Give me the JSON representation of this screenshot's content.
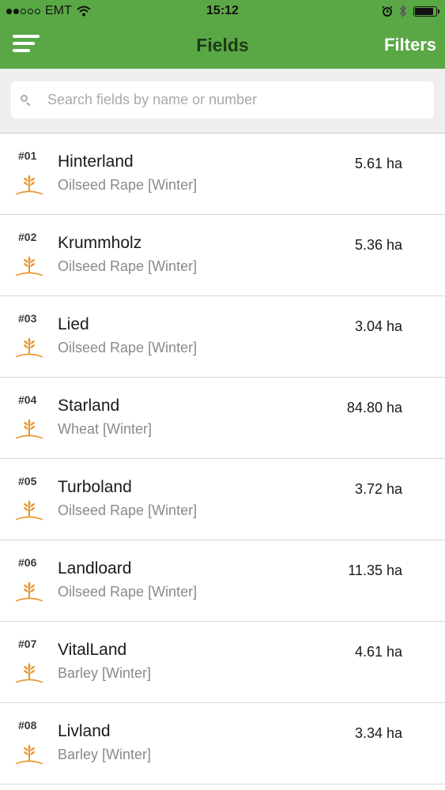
{
  "status_bar": {
    "carrier": "EMT",
    "time": "15:12",
    "battery_level": 0.9
  },
  "navbar": {
    "title": "Fields",
    "filters_label": "Filters",
    "menu_icon": "menu-icon"
  },
  "search": {
    "placeholder": "Search fields by name or number",
    "value": ""
  },
  "colors": {
    "header_green": "#5aa845",
    "crop_icon_orange": "#e8962a"
  },
  "fields": [
    {
      "number": "#01",
      "name": "Hinterland",
      "crop": "Oilseed Rape [Winter]",
      "area": "5.61 ha"
    },
    {
      "number": "#02",
      "name": "Krummholz",
      "crop": "Oilseed Rape [Winter]",
      "area": "5.36 ha"
    },
    {
      "number": "#03",
      "name": "Lied",
      "crop": "Oilseed Rape [Winter]",
      "area": "3.04 ha"
    },
    {
      "number": "#04",
      "name": "Starland",
      "crop": "Wheat [Winter]",
      "area": "84.80 ha"
    },
    {
      "number": "#05",
      "name": "Turboland",
      "crop": "Oilseed Rape [Winter]",
      "area": "3.72 ha"
    },
    {
      "number": "#06",
      "name": "Landloard",
      "crop": "Oilseed Rape [Winter]",
      "area": "11.35 ha"
    },
    {
      "number": "#07",
      "name": "VitalLand",
      "crop": "Barley [Winter]",
      "area": "4.61 ha"
    },
    {
      "number": "#08",
      "name": "Livland",
      "crop": "Barley [Winter]",
      "area": "3.34 ha"
    }
  ]
}
